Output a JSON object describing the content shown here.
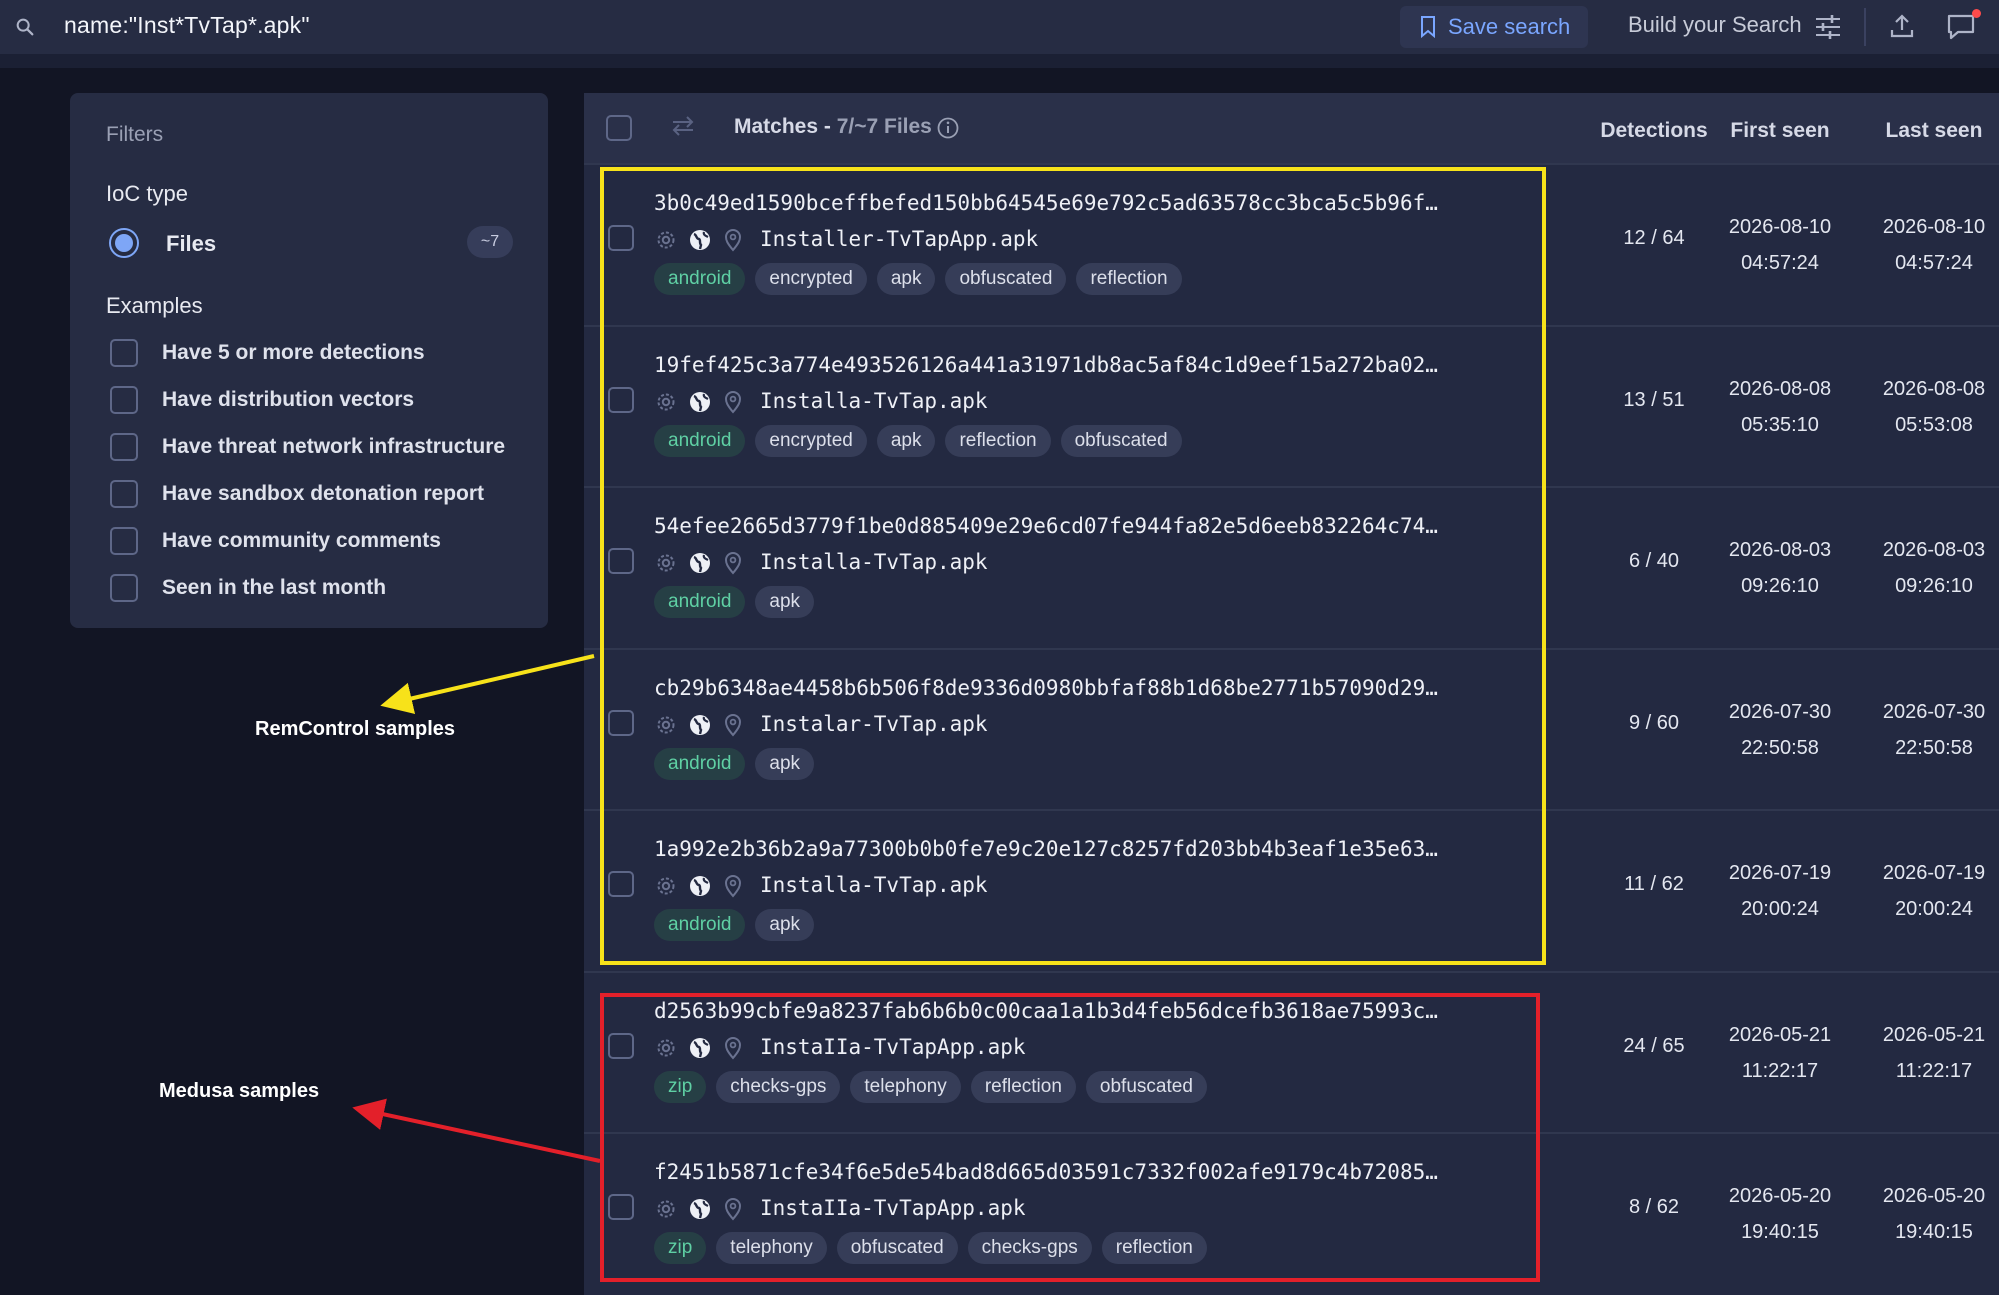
{
  "search": {
    "query": "name:\"Inst*TvTap*.apk\"",
    "save_label": "Save search",
    "build_label": "Build your Search"
  },
  "filters": {
    "title": "Filters",
    "ioc_type_label": "IoC type",
    "files_label": "Files",
    "files_count": "~7",
    "examples_label": "Examples",
    "examples": [
      "Have 5 or more detections",
      "Have distribution vectors",
      "Have threat network infrastructure",
      "Have sandbox detonation report",
      "Have community comments",
      "Seen in the last month"
    ]
  },
  "results": {
    "matches_label": "Matches - ",
    "matches_count": "7/~7 Files",
    "columns": {
      "detections": "Detections",
      "first_seen": "First seen",
      "last_seen": "Last seen"
    },
    "rows": [
      {
        "hash": "3b0c49ed1590bceffbefed150bb64545e69e792c5ad63578cc3bca5c5b96f…",
        "filename": "Installer-TvTapApp.apk",
        "tags": [
          "android",
          "encrypted",
          "apk",
          "obfuscated",
          "reflection"
        ],
        "detections": "12 / 64",
        "first_date": "2026-08-10",
        "first_time": "04:57:24",
        "last_date": "2026-08-10",
        "last_time": "04:57:24"
      },
      {
        "hash": "19fef425c3a774e493526126a441a31971db8ac5af84c1d9eef15a272ba02…",
        "filename": "Installa-TvTap.apk",
        "tags": [
          "android",
          "encrypted",
          "apk",
          "reflection",
          "obfuscated"
        ],
        "detections": "13 / 51",
        "first_date": "2026-08-08",
        "first_time": "05:35:10",
        "last_date": "2026-08-08",
        "last_time": "05:53:08"
      },
      {
        "hash": "54efee2665d3779f1be0d885409e29e6cd07fe944fa82e5d6eeb832264c74…",
        "filename": "Installa-TvTap.apk",
        "tags": [
          "android",
          "apk"
        ],
        "detections": "6 / 40",
        "first_date": "2026-08-03",
        "first_time": "09:26:10",
        "last_date": "2026-08-03",
        "last_time": "09:26:10"
      },
      {
        "hash": "cb29b6348ae4458b6b506f8de9336d0980bbfaf88b1d68be2771b57090d29…",
        "filename": "Instalar-TvTap.apk",
        "tags": [
          "android",
          "apk"
        ],
        "detections": "9 / 60",
        "first_date": "2026-07-30",
        "first_time": "22:50:58",
        "last_date": "2026-07-30",
        "last_time": "22:50:58"
      },
      {
        "hash": "1a992e2b36b2a9a77300b0b0fe7e9c20e127c8257fd203bb4b3eaf1e35e63…",
        "filename": "Installa-TvTap.apk",
        "tags": [
          "android",
          "apk"
        ],
        "detections": "11 / 62",
        "first_date": "2026-07-19",
        "first_time": "20:00:24",
        "last_date": "2026-07-19",
        "last_time": "20:00:24"
      },
      {
        "hash": "d2563b99cbfe9a8237fab6b6b0c00caa1a1b3d4feb56dcefb3618ae75993c…",
        "filename": "InstaIIa-TvTapApp.apk",
        "tags": [
          "zip",
          "checks-gps",
          "telephony",
          "reflection",
          "obfuscated"
        ],
        "detections": "24 / 65",
        "first_date": "2026-05-21",
        "first_time": "11:22:17",
        "last_date": "2026-05-21",
        "last_time": "11:22:17"
      },
      {
        "hash": "f2451b5871cfe34f6e5de54bad8d665d03591c7332f002afe9179c4b72085…",
        "filename": "InstaIIa-TvTapApp.apk",
        "tags": [
          "zip",
          "telephony",
          "obfuscated",
          "checks-gps",
          "reflection"
        ],
        "detections": "8 / 62",
        "first_date": "2026-05-20",
        "first_time": "19:40:15",
        "last_date": "2026-05-20",
        "last_time": "19:40:15"
      }
    ]
  },
  "annotations": {
    "remcontrol_label": "RemControl samples",
    "medusa_label": "Medusa samples",
    "remcontrol_color": "#f7e21a",
    "medusa_color": "#e3202a"
  },
  "icons": {
    "search": "search-icon",
    "save": "bookmark-icon",
    "tune": "tune-icon",
    "upload": "upload-icon",
    "chat": "chat-icon",
    "swap": "swap-icon",
    "info": "info-icon",
    "row": [
      "gear-icon",
      "globe-icon",
      "location-icon"
    ]
  },
  "colors": {
    "background": "#121524",
    "panel": "#262c43",
    "accent": "#7aa6ff",
    "tag_green": "#5fd0a4"
  }
}
